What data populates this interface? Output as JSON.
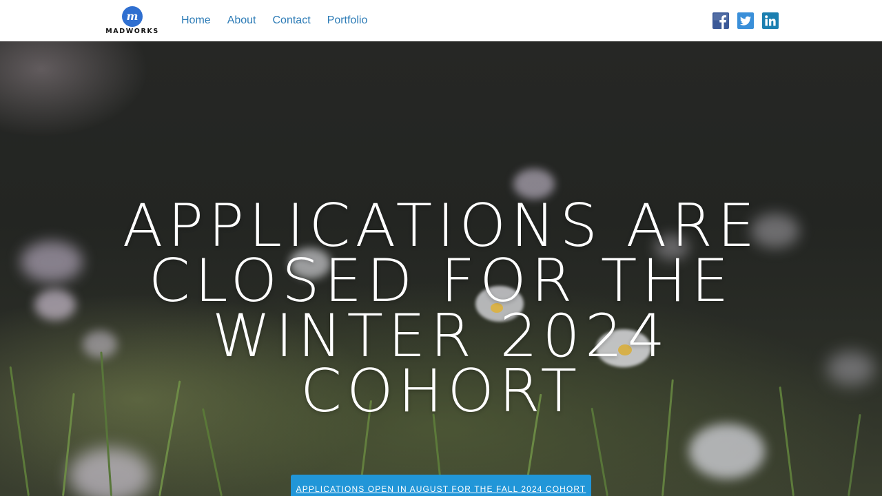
{
  "brand": {
    "name": "MADWORKS",
    "mark": "m",
    "color": "#2f6fd0"
  },
  "nav": {
    "items": [
      {
        "label": "Home"
      },
      {
        "label": "About"
      },
      {
        "label": "Contact"
      },
      {
        "label": "Portfolio"
      }
    ],
    "link_color": "#2c7bb6"
  },
  "social": [
    {
      "icon": "facebook-icon",
      "glyph": "f",
      "color": "#3b5998"
    },
    {
      "icon": "twitter-icon",
      "glyph": "t",
      "color": "#1da1f2"
    },
    {
      "icon": "linkedin-icon",
      "glyph": "in",
      "color": "#0e76a8"
    }
  ],
  "hero": {
    "headline": "APPLICATIONS ARE CLOSED FOR THE WINTER 2024 COHORT",
    "cta_label": "APPLICATIONS OPEN IN AUGUST FOR THE FALL 2024 COHORT",
    "cta_color": "#2196d8"
  }
}
